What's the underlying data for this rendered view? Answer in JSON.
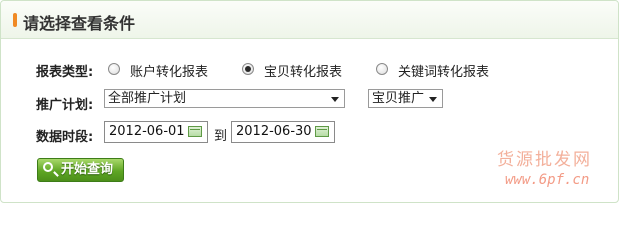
{
  "header": {
    "title": "请选择查看条件"
  },
  "report_type": {
    "label": "报表类型:",
    "options": [
      {
        "label": "账户转化报表",
        "checked": false
      },
      {
        "label": "宝贝转化报表",
        "checked": true
      },
      {
        "label": "关键词转化报表",
        "checked": false
      }
    ]
  },
  "plan": {
    "label": "推广计划:",
    "plan_select": "全部推广计划",
    "type_select": "宝贝推广"
  },
  "date_range": {
    "label": "数据时段:",
    "start": "2012-06-01",
    "separator": "到",
    "end": "2012-06-30"
  },
  "query_button": {
    "label": "开始查询"
  },
  "watermark": {
    "text": "货源批发网",
    "url": "www.6pf.cn"
  }
}
